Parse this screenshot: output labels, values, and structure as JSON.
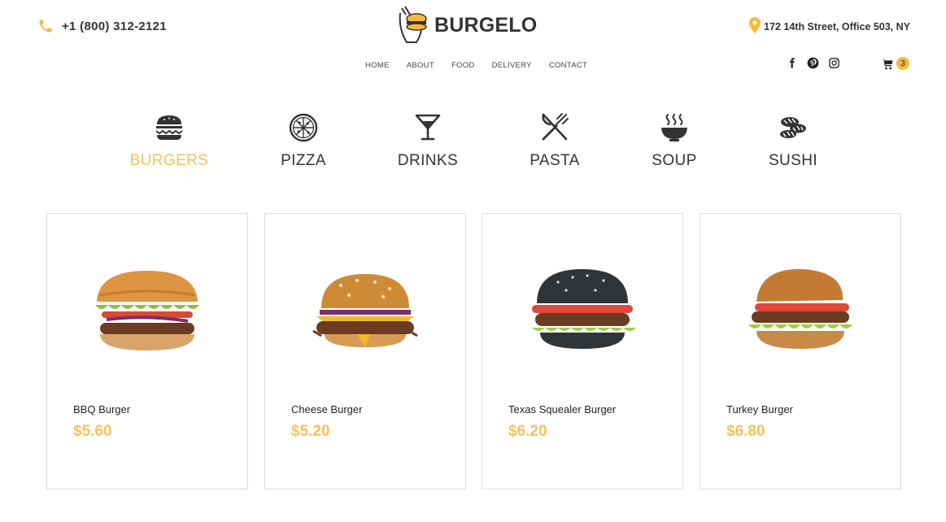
{
  "header": {
    "phone": "+1 (800) 312-2121",
    "brand": "BURGELO",
    "address": "172 14th Street, Office 503, NY",
    "cart_count": "3"
  },
  "nav": {
    "items": [
      "HOME",
      "ABOUT",
      "FOOD",
      "DELIVERY",
      "CONTACT"
    ]
  },
  "social": [
    "facebook-icon",
    "pinterest-icon",
    "instagram-icon"
  ],
  "categories": [
    {
      "label": "BURGERS",
      "icon": "burger-icon",
      "active": true
    },
    {
      "label": "PIZZA",
      "icon": "pizza-icon",
      "active": false
    },
    {
      "label": "DRINKS",
      "icon": "cocktail-icon",
      "active": false
    },
    {
      "label": "PASTA",
      "icon": "fork-knife-icon",
      "active": false
    },
    {
      "label": "SOUP",
      "icon": "soup-bowl-icon",
      "active": false
    },
    {
      "label": "SUSHI",
      "icon": "sushi-icon",
      "active": false
    }
  ],
  "products": [
    {
      "name": "BBQ Burger",
      "price": "$5.60",
      "bun": "#d9913f"
    },
    {
      "name": "Cheese Burger",
      "price": "$5.20",
      "bun": "#cf8a35"
    },
    {
      "name": "Texas Squealer Burger",
      "price": "$6.20",
      "bun": "#2f3438"
    },
    {
      "name": "Turkey Burger",
      "price": "$6.80",
      "bun": "#c57a34"
    }
  ],
  "colors": {
    "accent": "#f6c15a",
    "text": "#333333",
    "border": "#dcdcdc"
  }
}
